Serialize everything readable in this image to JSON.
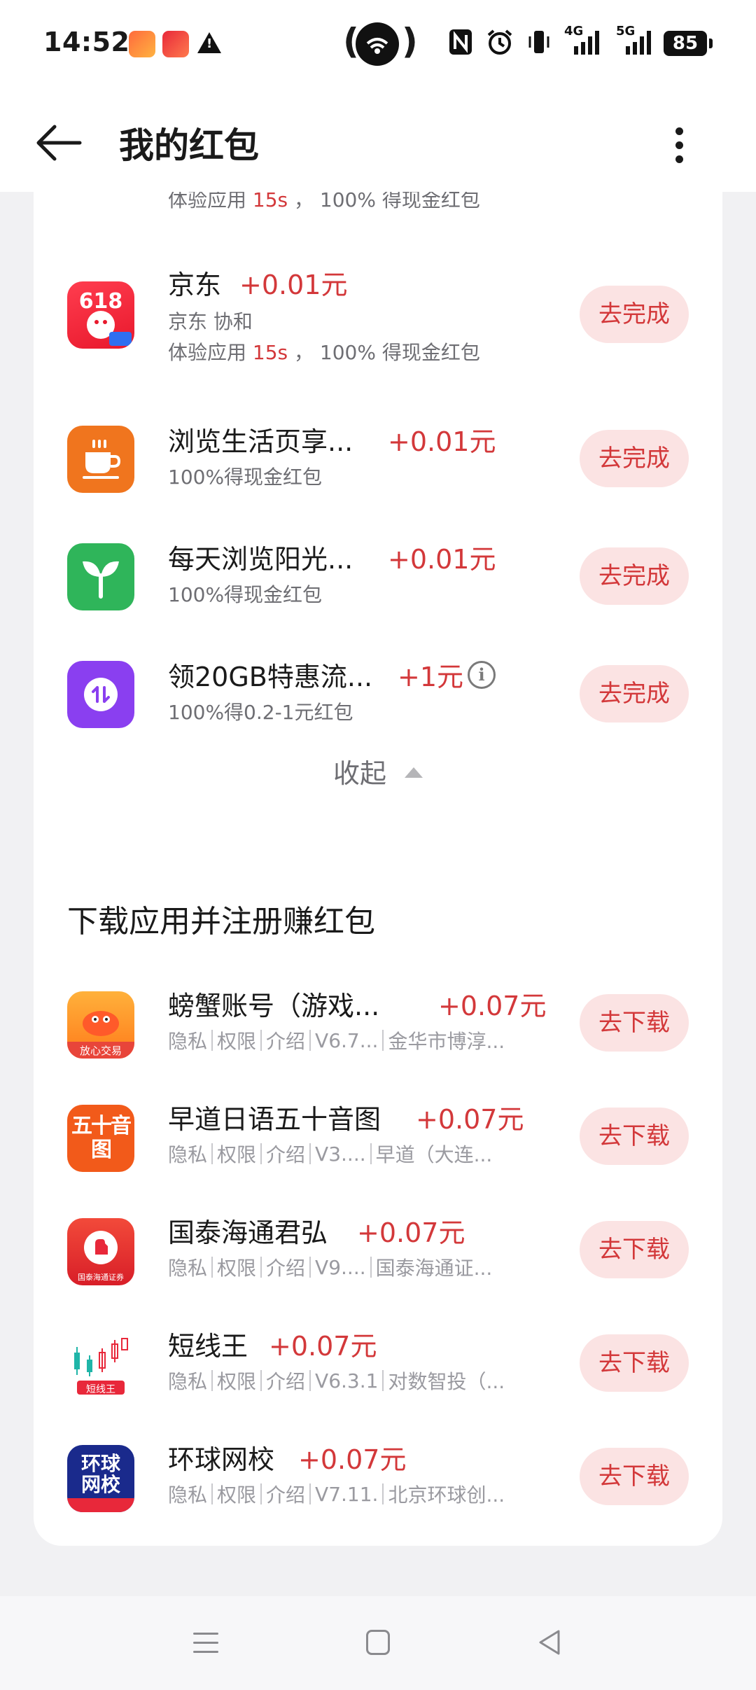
{
  "status_bar": {
    "time": "14:52",
    "network_4g": "4G",
    "network_5g": "5G",
    "battery": "85"
  },
  "header": {
    "title": "我的红包"
  },
  "task_card": {
    "partial_row": {
      "sub_prefix": "体验应用 ",
      "sub_time": "15s",
      "sub_suffix": " ， 100% 得现金红包"
    },
    "rows": [
      {
        "title": "京东",
        "reward": "+0.01元",
        "sub1": "京东 协和",
        "sub2_prefix": "体验应用 ",
        "sub2_time": "15s",
        "sub2_suffix": " ， 100% 得现金红包",
        "button": "去完成",
        "icon": "jd-618-icon"
      },
      {
        "title": "浏览生活页享...",
        "reward": "+0.01元",
        "sub1": "100%得现金红包",
        "button": "去完成",
        "icon": "coffee-cup-icon"
      },
      {
        "title": "每天浏览阳光...",
        "reward": "+0.01元",
        "sub1": "100%得现金红包",
        "button": "去完成",
        "icon": "sprout-icon"
      },
      {
        "title": "领20GB特惠流...",
        "reward": "+1元",
        "sub1": "100%得0.2-1元红包",
        "button": "去完成",
        "icon": "data-transfer-icon",
        "info": "i"
      }
    ],
    "collapse_label": "收起"
  },
  "download_card": {
    "title": "下载应用并注册赚红包",
    "meta_labels": [
      "隐私",
      "权限",
      "介绍"
    ],
    "rows": [
      {
        "title": "螃蟹账号（游戏...",
        "reward": "+0.07元",
        "version": "V6.7...",
        "developer": "金华市博淳...",
        "button": "去下载",
        "icon_text": "放心交易"
      },
      {
        "title": "早道日语五十音图",
        "reward": "+0.07元",
        "version": "V3....",
        "developer": "早道（大连...",
        "button": "去下载",
        "icon_text": "五十音图"
      },
      {
        "title": "国泰海通君弘",
        "reward": "+0.07元",
        "version": "V9....",
        "developer": "国泰海通证...",
        "button": "去下载",
        "icon_text": "国泰海通证券"
      },
      {
        "title": "短线王",
        "reward": "+0.07元",
        "version": "V6.3.1",
        "developer": "对数智投（...",
        "button": "去下载",
        "icon_text": "短线王"
      },
      {
        "title": "环球网校",
        "reward": "+0.07元",
        "version": "V7.11.",
        "developer": "北京环球创...",
        "button": "去下载",
        "icon_text": "环球网校"
      }
    ]
  },
  "colors": {
    "accent_red": "#d3383a",
    "button_bg": "#fbe3e3",
    "page_bg": "#f1f1f3"
  }
}
